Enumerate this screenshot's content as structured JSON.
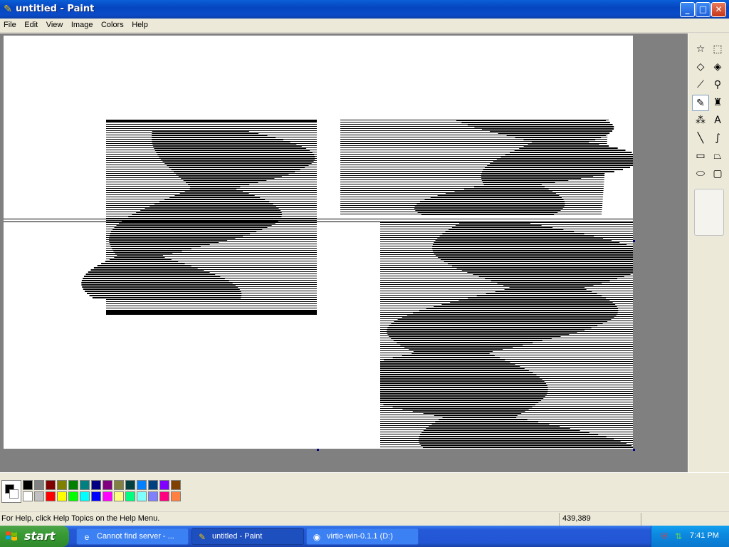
{
  "window": {
    "title": "untitled - Paint",
    "controls": {
      "minimize": "_",
      "maximize": "□",
      "close": "✕"
    }
  },
  "menu": [
    "File",
    "Edit",
    "View",
    "Image",
    "Colors",
    "Help"
  ],
  "tools": [
    {
      "name": "free-form-select-icon",
      "glyph": "☆"
    },
    {
      "name": "select-icon",
      "glyph": "⬚"
    },
    {
      "name": "eraser-icon",
      "glyph": "◇"
    },
    {
      "name": "fill-with-color-icon",
      "glyph": "◈"
    },
    {
      "name": "pick-color-icon",
      "glyph": "⟋"
    },
    {
      "name": "magnifier-icon",
      "glyph": "⚲"
    },
    {
      "name": "pencil-icon",
      "glyph": "✎",
      "active": true
    },
    {
      "name": "brush-icon",
      "glyph": "♜"
    },
    {
      "name": "airbrush-icon",
      "glyph": "⁂"
    },
    {
      "name": "text-icon",
      "glyph": "A"
    },
    {
      "name": "line-icon",
      "glyph": "╲"
    },
    {
      "name": "curve-icon",
      "glyph": "∫"
    },
    {
      "name": "rectangle-icon",
      "glyph": "▭"
    },
    {
      "name": "polygon-icon",
      "glyph": "⏢"
    },
    {
      "name": "ellipse-icon",
      "glyph": "⬭"
    },
    {
      "name": "rounded-rectangle-icon",
      "glyph": "▢"
    }
  ],
  "palette": {
    "foreground": "#000000",
    "background": "#ffffff",
    "top_row": [
      "#000000",
      "#808080",
      "#800000",
      "#808000",
      "#008000",
      "#008080",
      "#000080",
      "#800080",
      "#808040",
      "#004040",
      "#0080ff",
      "#004080",
      "#8000ff",
      "#804000"
    ],
    "bottom_row": [
      "#ffffff",
      "#c0c0c0",
      "#ff0000",
      "#ffff00",
      "#00ff00",
      "#00ffff",
      "#0000ff",
      "#ff00ff",
      "#ffff80",
      "#00ff80",
      "#80ffff",
      "#8080ff",
      "#ff0080",
      "#ff8040"
    ]
  },
  "status": {
    "help": "For Help, click Help Topics on the Help Menu.",
    "coords": "439,389"
  },
  "taskbar": {
    "start": "start",
    "tasks": [
      {
        "label": "Cannot find server - ...",
        "icon": "browser-icon",
        "glyph": "e"
      },
      {
        "label": "untitled - Paint",
        "icon": "paint-icon",
        "glyph": "✎",
        "active": true
      },
      {
        "label": "virtio-win-0.1.1 (D:)",
        "icon": "cd-drive-icon",
        "glyph": "◉"
      }
    ],
    "clock": "7:41 PM"
  }
}
